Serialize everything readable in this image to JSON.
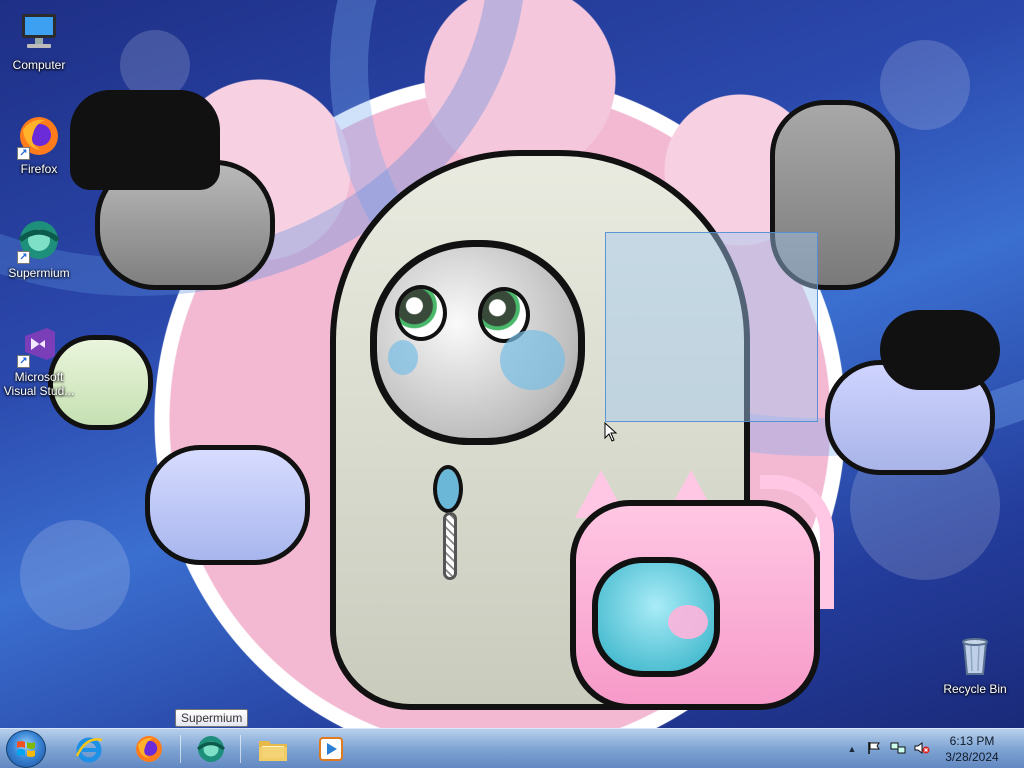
{
  "desktop": {
    "icons": [
      {
        "label": "Computer",
        "icon": "computer-icon",
        "shortcut": false
      },
      {
        "label": "Firefox",
        "icon": "firefox-icon",
        "shortcut": true
      },
      {
        "label": "Supermium",
        "icon": "supermium-icon",
        "shortcut": true
      },
      {
        "label": "Microsoft Visual Stud...",
        "icon": "visual-studio-icon",
        "shortcut": true
      },
      {
        "label": "Recycle Bin",
        "icon": "recycle-bin-icon",
        "shortcut": false
      }
    ],
    "wallpaper": "cartoon-space-animals"
  },
  "tooltip": {
    "text": "Supermium"
  },
  "taskbar": {
    "pinned": [
      {
        "name": "Internet Explorer",
        "icon": "internet-explorer-icon"
      },
      {
        "name": "Firefox",
        "icon": "firefox-icon"
      },
      {
        "name": "Supermium",
        "icon": "supermium-icon"
      },
      {
        "name": "Windows Explorer",
        "icon": "folder-icon"
      },
      {
        "name": "Windows Media Player",
        "icon": "media-player-icon"
      }
    ],
    "tray": {
      "show_hidden": "▲",
      "time": "6:13 PM",
      "date": "3/28/2024"
    }
  },
  "colors": {
    "taskbar": "#7aa3d6",
    "selection": "#a0c8f0",
    "accent": "#1b4f9c"
  }
}
